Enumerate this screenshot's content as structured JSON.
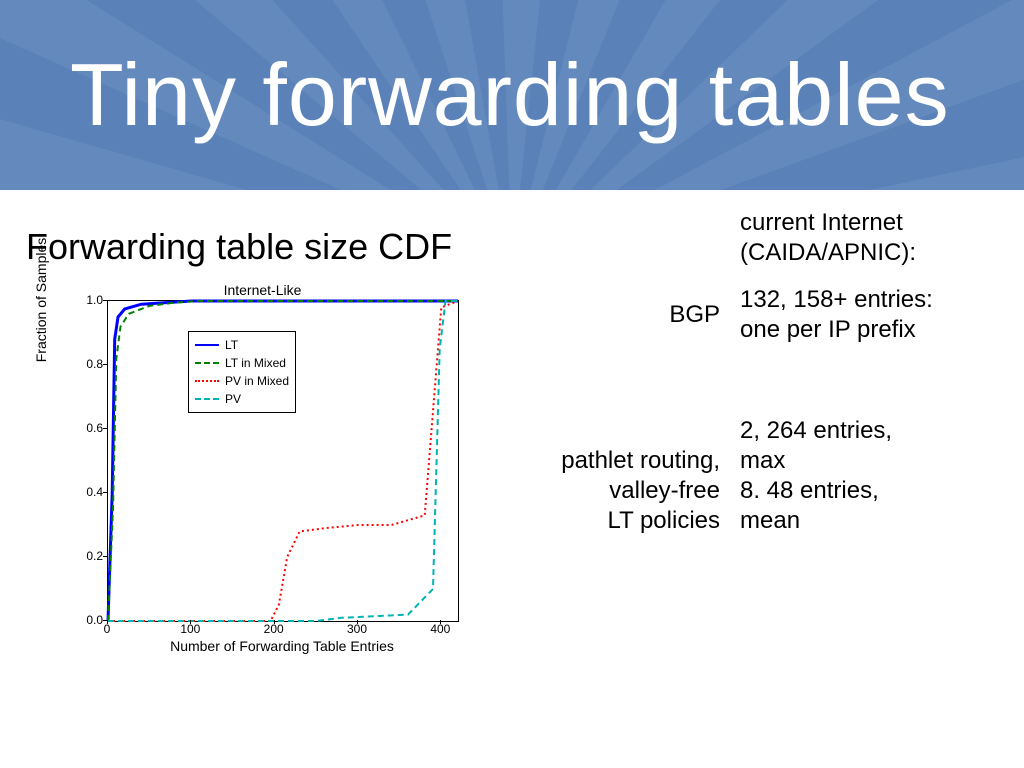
{
  "banner": {
    "title": "Tiny forwarding tables"
  },
  "subtitle": "Forwarding table size CDF",
  "notes": {
    "context": "current Internet\n(CAIDA/APNIC):",
    "bgp_label": "BGP",
    "bgp_val": "132, 158+ entries:\none per IP prefix",
    "pr_label": "pathlet routing,\nvalley-free\nLT policies",
    "pr_val": "2, 264 entries,\nmax\n8. 48 entries,\nmean"
  },
  "chart_data": {
    "type": "line",
    "title": "Internet-Like",
    "xlabel": "Number of Forwarding Table Entries",
    "ylabel": "Fraction of Samples",
    "xlim": [
      0,
      420
    ],
    "ylim": [
      0,
      1
    ],
    "xticks": [
      0,
      100,
      200,
      300,
      400
    ],
    "yticks": [
      0.0,
      0.2,
      0.4,
      0.6,
      0.8,
      1.0
    ],
    "legend": [
      "LT",
      "LT in Mixed",
      "PV in Mixed",
      "PV"
    ],
    "legend_colors": [
      "#0000ff",
      "#008000",
      "#ff0000",
      "#00b3b3"
    ],
    "legend_styles": [
      "solid",
      "dashed",
      "dotted",
      "dashed"
    ],
    "series": [
      {
        "name": "LT",
        "x": [
          0,
          5,
          8,
          12,
          20,
          40,
          70,
          100,
          420
        ],
        "y": [
          0.0,
          0.4,
          0.88,
          0.95,
          0.975,
          0.99,
          0.995,
          1.0,
          1.0
        ]
      },
      {
        "name": "LT in Mixed",
        "x": [
          0,
          6,
          10,
          15,
          25,
          50,
          80,
          110,
          420
        ],
        "y": [
          0.0,
          0.35,
          0.82,
          0.92,
          0.96,
          0.985,
          0.995,
          1.0,
          1.0
        ]
      },
      {
        "name": "PV in Mixed",
        "x": [
          0,
          195,
          205,
          215,
          230,
          260,
          300,
          340,
          380,
          400,
          420
        ],
        "y": [
          0.0,
          0.0,
          0.05,
          0.2,
          0.28,
          0.29,
          0.3,
          0.3,
          0.33,
          0.98,
          1.0
        ]
      },
      {
        "name": "PV",
        "x": [
          0,
          250,
          280,
          320,
          360,
          390,
          398,
          405,
          420
        ],
        "y": [
          0.0,
          0.0,
          0.01,
          0.015,
          0.02,
          0.1,
          0.85,
          1.0,
          1.0
        ]
      }
    ]
  }
}
